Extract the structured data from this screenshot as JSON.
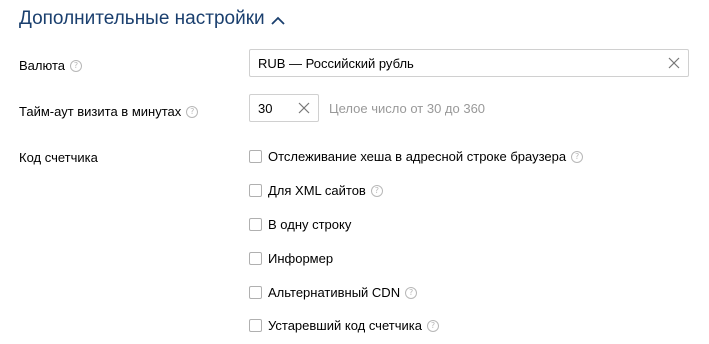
{
  "section": {
    "title": "Дополнительные настройки"
  },
  "currency": {
    "label": "Валюта",
    "value": "RUB — Российский рубль"
  },
  "timeout": {
    "label": "Тайм-аут визита в минутах",
    "value": "30",
    "hint": "Целое число от 30 до 360"
  },
  "counter_code": {
    "label": "Код счетчика",
    "options": [
      {
        "label": "Отслеживание хеша в адресной строке браузера",
        "help": true,
        "checked": false
      },
      {
        "label": "Для XML сайтов",
        "help": true,
        "checked": false
      },
      {
        "label": "В одну строку",
        "help": false,
        "checked": false
      },
      {
        "label": "Информер",
        "help": false,
        "checked": false
      },
      {
        "label": "Альтернативный CDN",
        "help": true,
        "checked": false
      },
      {
        "label": "Устаревший код счетчика",
        "help": true,
        "checked": false
      }
    ]
  },
  "help_glyph": "?"
}
